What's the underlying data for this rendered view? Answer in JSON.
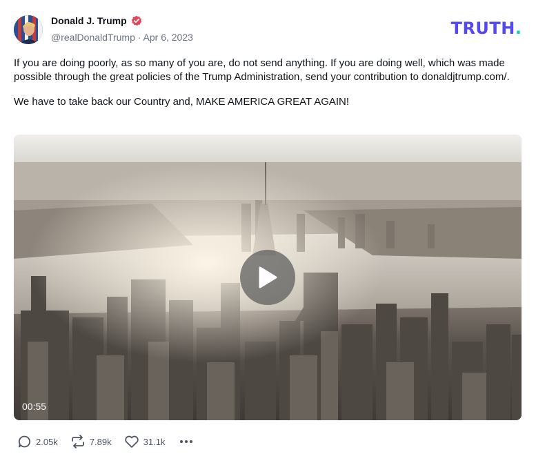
{
  "author": {
    "display_name": "Donald J. Trump",
    "handle": "@realDonaldTrump",
    "date": "Apr 6, 2023",
    "meta_separator": " · "
  },
  "brand": {
    "name": "TRUTH",
    "dot": ".",
    "color": "#5448ee",
    "dot_color": "#00d6b0"
  },
  "post": {
    "paragraph_1": "If you are doing poorly, as so many of you are, do not send anything. If you are doing well, which was made possible through the great policies of the Trump Administration, send your contribution to donaldjtrump.com/.",
    "paragraph_2": "We have to take back our Country and, MAKE AMERICA GREAT AGAIN!"
  },
  "video": {
    "duration": "00:55",
    "play_icon": "play-icon"
  },
  "actions": {
    "replies": "2.05k",
    "retruths": "7.89k",
    "likes": "31.1k"
  },
  "colors": {
    "verified_badge": "#e0475d",
    "text_primary": "#0f1419",
    "text_secondary": "#6b7280"
  }
}
